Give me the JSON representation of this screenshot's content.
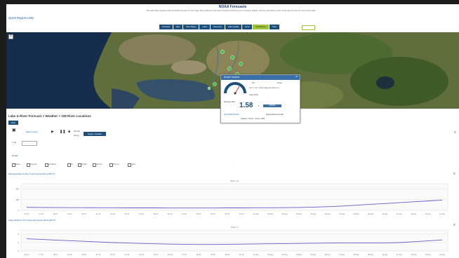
{
  "header": {
    "title": "NOAA Forecasts",
    "subtitle": "This table below displays real-time NOAA forecasts for river stage, flow predictions and links to locations closest to your monitoring catalog. Click any tab below to jump to that view and see the most current data.",
    "quick_links": "Quick Region Links"
  },
  "nav": {
    "items": [
      "Forecasts",
      "Rain",
      "River Stages",
      "Lakes",
      "Reservoirs",
      "Water Quality",
      "Snow",
      "Soil Moisture",
      "Tides"
    ],
    "active_index": 7
  },
  "map": {
    "zoom_control": "+",
    "popup": {
      "title": "RIVER TRENDS",
      "close": "×",
      "col_left": "Site",
      "col_right": "Gauge",
      "site_id": "DRYC1 DRY CREEK NEAR GEYSERVILLE",
      "stage_label": "Gage Height",
      "value_label": "Discharge Rate",
      "value_unit": "ft",
      "value": "1.58",
      "status": "NORMAL",
      "link_left": "View NOAA Forecast",
      "link_right": "Request Review as Alert",
      "footer": "Updated: 7:00 am · Source: NWS"
    }
  },
  "panel": {
    "section_title": "Lake & River Forecast > Weather > 108 River Locations",
    "tag": "Next",
    "view_label": "Select a view",
    "refresh_label": "Refresh",
    "update_button": "Apply / Update",
    "range_label": "Range",
    "range_from": "1 day",
    "page_label": "1 of",
    "page_value": "1 of 1",
    "sub_tab": "Details",
    "option_labels": [
      "Meter",
      "Account",
      "Locations",
      "All",
      "Graph",
      "Sensor",
      "Time to",
      "View"
    ],
    "chart1_title": "Discharge Rate for Dry Creek (Geyserville) at DRYC1",
    "chart2_title": "Gage Height for Dry Creek near Geyserville at DRYC1",
    "menu_icon": "≡"
  },
  "chart_data": [
    {
      "type": "line",
      "title": "Discharge Rate for Dry Creek (Geyserville) at DRYC1",
      "subtitle": "Stage / cfs",
      "x": [
        "16-Jul",
        "17-Jul",
        "18-Jul",
        "19-Jul",
        "20-Jul",
        "21-Jul",
        "22-Jul",
        "23-Jul",
        "24-Jul",
        "25-Jul",
        "26-Jul",
        "27-Jul",
        "28-Jul",
        "29-Jul",
        "30-Jul",
        "31-Jul",
        "01-Aug",
        "02-Aug",
        "03-Aug",
        "04-Aug",
        "05-Aug",
        "06-Aug",
        "07-Aug",
        "08-Aug",
        "09-Aug",
        "10-Aug",
        "11-Aug",
        "12-Aug",
        "13-Aug",
        "14-Aug"
      ],
      "y_ticks": [
        "0",
        "100",
        "200"
      ],
      "ylim": [
        0,
        250
      ],
      "series": [
        {
          "values": [
            28,
            27,
            26,
            25,
            25,
            24,
            24,
            23,
            23,
            23,
            22,
            22,
            22,
            22,
            23,
            23,
            24,
            24,
            25,
            27,
            30,
            34,
            40,
            48,
            56,
            64,
            72,
            80,
            88,
            96
          ]
        }
      ],
      "color": "#6a5acd",
      "grid": true
    },
    {
      "type": "line",
      "title": "Gage Height for Dry Creek near Geyserville at DRYC1",
      "subtitle": "Stage / ft",
      "x": [
        "16-Jul",
        "17-Jul",
        "18-Jul",
        "19-Jul",
        "20-Jul",
        "21-Jul",
        "22-Jul",
        "23-Jul",
        "24-Jul",
        "25-Jul",
        "26-Jul",
        "27-Jul",
        "28-Jul",
        "29-Jul",
        "30-Jul",
        "31-Jul",
        "01-Aug",
        "02-Aug",
        "03-Aug",
        "04-Aug",
        "05-Aug",
        "06-Aug",
        "07-Aug",
        "08-Aug",
        "09-Aug",
        "10-Aug",
        "11-Aug",
        "12-Aug",
        "13-Aug",
        "14-Aug"
      ],
      "y_ticks": [
        "0",
        "1",
        "2"
      ],
      "ylim": [
        0,
        2.5
      ],
      "series": [
        {
          "values": [
            1.45,
            1.38,
            1.3,
            1.22,
            1.15,
            1.08,
            1.0,
            0.95,
            0.9,
            0.86,
            0.82,
            0.8,
            0.78,
            0.78,
            0.8,
            0.82,
            0.84,
            0.86,
            0.88,
            0.9,
            0.92,
            0.94,
            0.95,
            0.96,
            0.96,
            0.96,
            1.0,
            1.1,
            1.2,
            1.32
          ]
        }
      ],
      "color": "#6a5acd",
      "grid": true
    }
  ]
}
